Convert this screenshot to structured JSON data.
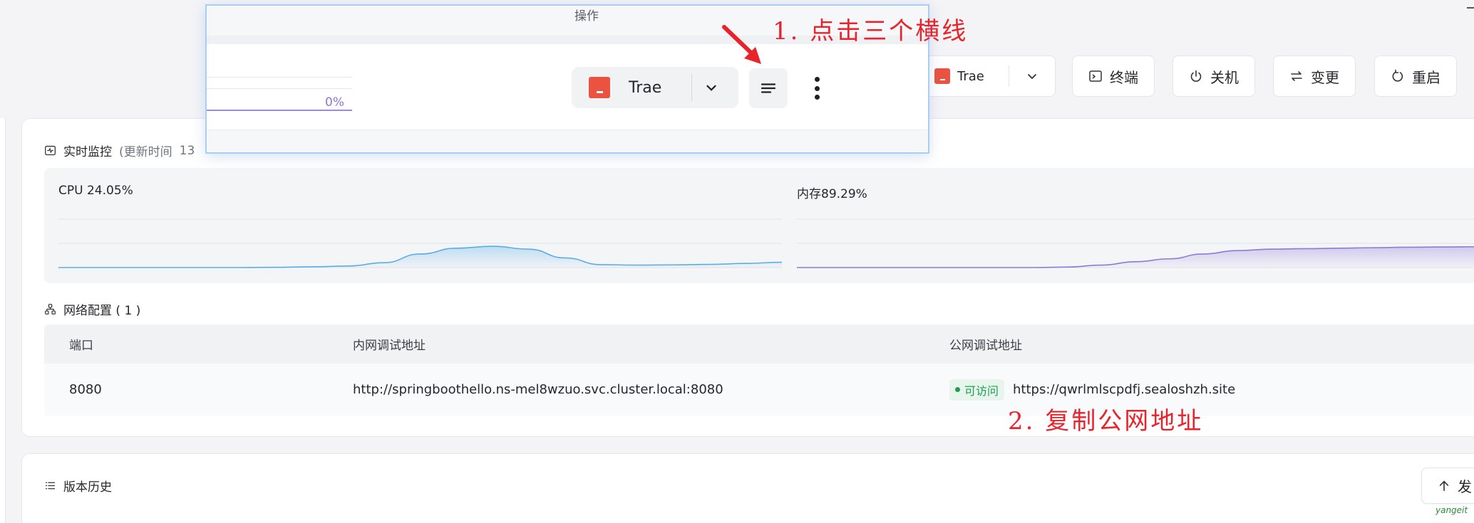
{
  "toolbar": {
    "runtime_select": "Trae",
    "terminal": "终端",
    "shutdown": "关机",
    "change": "变更",
    "restart": "重启"
  },
  "monitor": {
    "title": "实时监控",
    "update_prefix": "(更新时间",
    "update_time": "13",
    "cpu_label": "CPU 24.05%",
    "mem_label": "内存89.29%"
  },
  "chart_data": [
    {
      "type": "area",
      "title": "CPU 24.05%",
      "x": [
        0,
        1,
        2,
        3,
        4,
        5,
        6,
        7,
        8,
        9,
        10,
        11,
        12,
        13,
        14,
        15,
        16,
        17,
        18,
        19,
        20
      ],
      "y": [
        0,
        0,
        0,
        0,
        0,
        0,
        0.5,
        1.5,
        3,
        10,
        28,
        40,
        44,
        38,
        20,
        6,
        5,
        5.5,
        6.5,
        8.5,
        11
      ],
      "ylim": [
        0,
        100
      ],
      "color": "#5aaee6"
    },
    {
      "type": "area",
      "title": "内存89.29%",
      "x": [
        0,
        1,
        2,
        3,
        4,
        5,
        6,
        7,
        8,
        9,
        10,
        11,
        12,
        13,
        14,
        15,
        16,
        17,
        18,
        19,
        20
      ],
      "y": [
        0,
        0,
        0,
        0,
        0,
        0,
        0,
        0,
        1,
        5,
        12,
        18,
        28,
        35,
        38,
        39,
        40,
        41,
        42,
        42.5,
        43
      ],
      "ylim": [
        0,
        100
      ],
      "color": "#8e7ad8"
    }
  ],
  "network": {
    "title": "网络配置 ( 1 )",
    "headers": [
      "端口",
      "内网调试地址",
      "公网调试地址"
    ],
    "row": {
      "port": "8080",
      "internal": "http://springboothello.ns-mel8wzuo.svc.cluster.local:8080",
      "status": "可访问",
      "public": "https://qwrlmlscpdfj.sealoshzh.site"
    }
  },
  "history": {
    "title": "版本历史",
    "publish_button": "发"
  },
  "popup": {
    "title": "操作",
    "percent": "0%",
    "runtime": "Trae"
  },
  "annotations": {
    "step1": "1. 点击三个横线",
    "step2": "2. 复制公网地址"
  },
  "watermark": "yangeit",
  "colors": {
    "accent_red": "#e8232b",
    "trae_icon": "#e9533f",
    "cpu_line": "#5aaee6",
    "mem_line": "#8e7ad8",
    "status_green": "#1f9d55"
  }
}
